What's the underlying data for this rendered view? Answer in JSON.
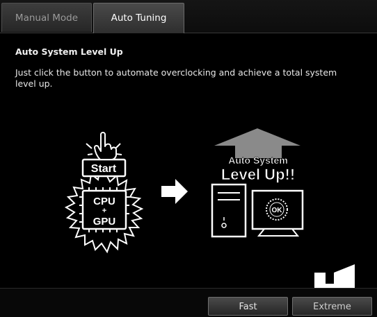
{
  "tabs": [
    {
      "label": "Manual Mode",
      "active": false
    },
    {
      "label": "Auto Tuning",
      "active": true
    }
  ],
  "content": {
    "heading": "Auto System Level Up",
    "description": "Just click the button to automate overclocking and achieve a total system level up."
  },
  "illustration": {
    "start_label": "Start",
    "chip_line1": "CPU",
    "chip_plus": "+",
    "chip_line2": "GPU",
    "banner_line1": "Auto System",
    "banner_line2": "Level Up!!",
    "ok_label": "OK"
  },
  "buttons": {
    "fast_label": "Fast",
    "extreme_label": "Extreme"
  },
  "colors": {
    "background": "#000000",
    "text": "#ffffff",
    "logo": "#ffffff"
  },
  "icons": [
    "hand-pointer-icon",
    "chip-icon",
    "arrow-right-icon",
    "arrow-up-icon",
    "computer-icon",
    "monitor-icon",
    "logo-icon"
  ]
}
